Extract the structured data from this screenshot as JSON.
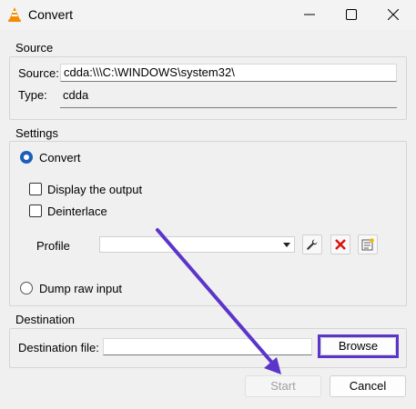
{
  "window": {
    "title": "Convert"
  },
  "source": {
    "group_title": "Source",
    "source_label": "Source:",
    "source_value": "cdda:\\\\\\C:\\WINDOWS\\system32\\",
    "type_label": "Type:",
    "type_value": "cdda"
  },
  "settings": {
    "group_title": "Settings",
    "convert_label": "Convert",
    "display_output_label": "Display the output",
    "deinterlace_label": "Deinterlace",
    "profile_label": "Profile",
    "profile_value": "",
    "dump_raw_label": "Dump raw input",
    "convert_selected": true,
    "dump_raw_selected": false,
    "display_output_checked": false,
    "deinterlace_checked": false
  },
  "destination": {
    "group_title": "Destination",
    "file_label": "Destination file:",
    "file_value": "",
    "browse_label": "Browse"
  },
  "footer": {
    "start_label": "Start",
    "cancel_label": "Cancel"
  },
  "annotation": {
    "highlight_color": "#5b35c9",
    "arrow_color": "#5b35c9"
  },
  "icons": {
    "app": "vlc-cone-icon",
    "minimize": "minimize-icon",
    "maximize": "maximize-icon",
    "close": "close-icon",
    "edit_profile": "wrench-icon",
    "delete_profile": "delete-x-icon",
    "new_profile": "new-profile-icon"
  }
}
